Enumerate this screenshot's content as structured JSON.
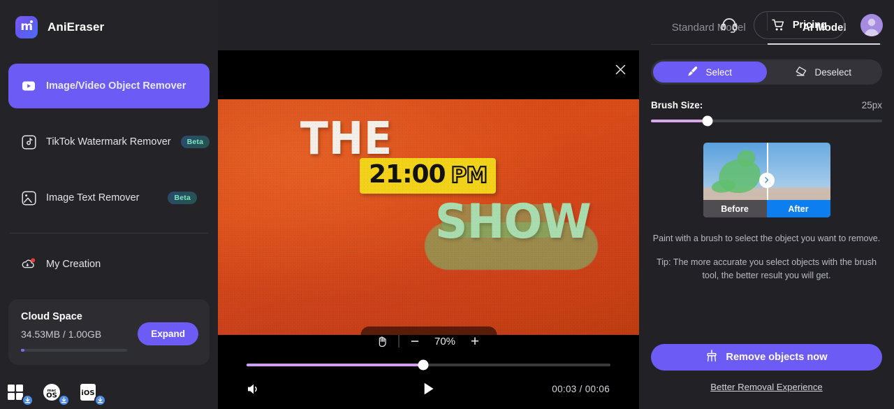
{
  "app": {
    "name": "AniEraser",
    "logo_icon": "anieraser-logo-icon",
    "accent": "#6c5cf5"
  },
  "header": {
    "support_icon": "headset-icon",
    "pricing_label": "Pricing",
    "pricing_icon": "shopping-cart-icon",
    "avatar_icon": "user-avatar-icon"
  },
  "sidebar": {
    "items": [
      {
        "label": "Image/Video Object Remover",
        "icon": "video-play-icon",
        "badge": "",
        "active": true
      },
      {
        "label": "TikTok Watermark Remover",
        "icon": "music-note-icon",
        "badge": "Beta",
        "active": false
      },
      {
        "label": "Image Text Remover",
        "icon": "image-text-icon",
        "badge": "Beta",
        "active": false
      }
    ],
    "creation": {
      "label": "My Creation",
      "icon": "cloud-download-icon",
      "has_dot": true
    },
    "cloud": {
      "title": "Cloud Space",
      "usage": "34.53MB / 1.00GB",
      "expand_label": "Expand",
      "percent": 3.4
    },
    "platforms": [
      {
        "name": "windows-download-icon",
        "label": ""
      },
      {
        "name": "macos-download-icon",
        "label": "macOS"
      },
      {
        "name": "ios-download-icon",
        "label": "iOS"
      }
    ]
  },
  "video": {
    "close_icon": "close-icon",
    "frame": {
      "line1": "THE",
      "time": "21:00",
      "meridiem": "PM",
      "line3": "SHOW"
    },
    "zoom": {
      "hand_icon": "hand-pan-icon",
      "minus_label": "−",
      "percent": "70%",
      "plus_label": "+"
    },
    "controls": {
      "volume_icon": "volume-on-icon",
      "play_icon": "play-icon",
      "time_current": "00:03",
      "time_total": "00:06",
      "time_display": "00:03 / 00:06",
      "progress_percent": 48.5
    }
  },
  "panel": {
    "tabs": [
      {
        "label": "Standard Model",
        "active": false
      },
      {
        "label": "AI Model",
        "active": true
      }
    ],
    "tools": [
      {
        "label": "Select",
        "icon": "brush-icon",
        "active": true
      },
      {
        "label": "Deselect",
        "icon": "eraser-icon",
        "active": false
      }
    ],
    "brush": {
      "label": "Brush Size:",
      "value": "25px",
      "percent": 24.5
    },
    "preview": {
      "before_label": "Before",
      "after_label": "After",
      "arrow_icon": "chevron-right-icon"
    },
    "hint": "Paint with a brush to select the object you want to remove.",
    "tip": "Tip: The more accurate you select objects with the brush tool, the better result you will get.",
    "cta_label": "Remove objects now",
    "cta_icon": "broom-icon",
    "better_link": "Better Removal Experience"
  }
}
